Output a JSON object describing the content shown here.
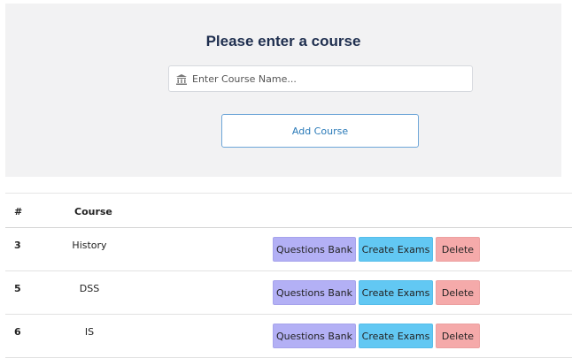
{
  "form": {
    "title": "Please enter a course",
    "input_placeholder": "Enter Course Name...",
    "input_value": "",
    "add_button_label": "Add Course"
  },
  "table": {
    "headers": {
      "number": "#",
      "course": "Course"
    },
    "rows": [
      {
        "number": "3",
        "course": "History",
        "questions_bank_label": "Questions Bank",
        "create_exams_label": "Create Exams",
        "delete_label": "Delete"
      },
      {
        "number": "5",
        "course": "DSS",
        "questions_bank_label": "Questions Bank",
        "create_exams_label": "Create Exams",
        "delete_label": "Delete"
      },
      {
        "number": "6",
        "course": "IS",
        "questions_bank_label": "Questions Bank",
        "create_exams_label": "Create Exams",
        "delete_label": "Delete"
      }
    ]
  },
  "icons": {
    "input_icon": "institution-icon"
  },
  "colors": {
    "title": "#1f2f4f",
    "add_button_border": "#6ea6d8",
    "questions_bank_button": "#b3b0f5",
    "create_exams_button": "#62c8f3",
    "delete_button": "#f5aaaa"
  }
}
